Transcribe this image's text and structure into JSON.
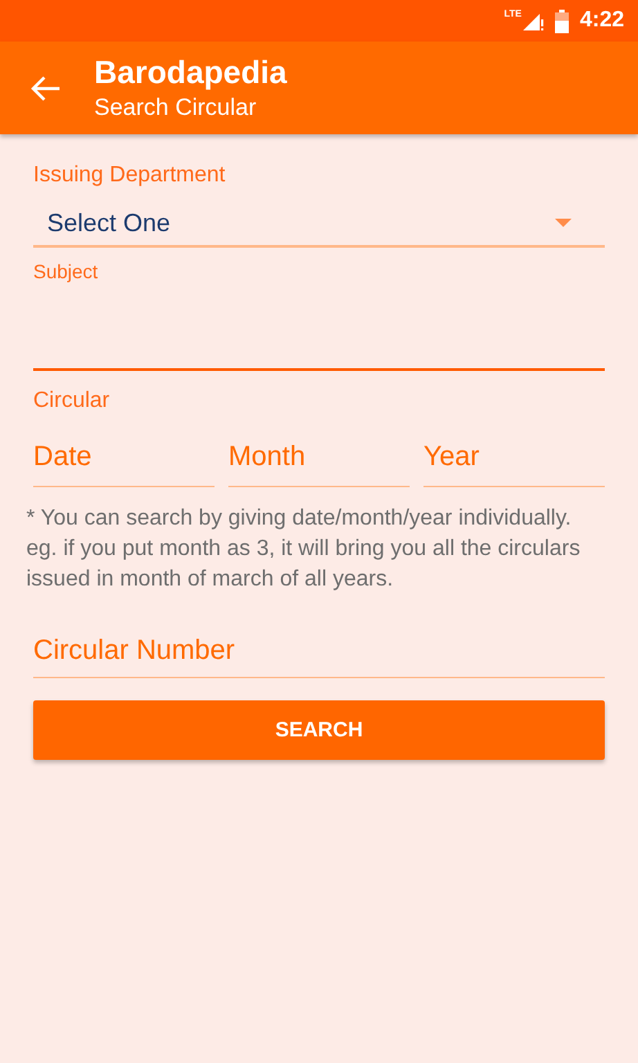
{
  "status_bar": {
    "network": "LTE",
    "time": "4:22"
  },
  "app_bar": {
    "title": "Barodapedia",
    "subtitle": "Search Circular"
  },
  "department": {
    "label": "Issuing Department",
    "value": "Select One"
  },
  "subject": {
    "label": "Subject",
    "focused": true
  },
  "circular": {
    "label": "Circular",
    "fields": [
      {
        "placeholder": "Date",
        "focused": false
      },
      {
        "placeholder": "Month",
        "focused": false
      },
      {
        "placeholder": "Year",
        "focused": false
      }
    ]
  },
  "note": "* You can search by giving date/month/year individually. eg. if you put month as 3, it will bring you all the circulars issued in month of march of all years.",
  "circular_number": {
    "placeholder": "Circular Number",
    "focused": false
  },
  "search_button": "SEARCH"
}
